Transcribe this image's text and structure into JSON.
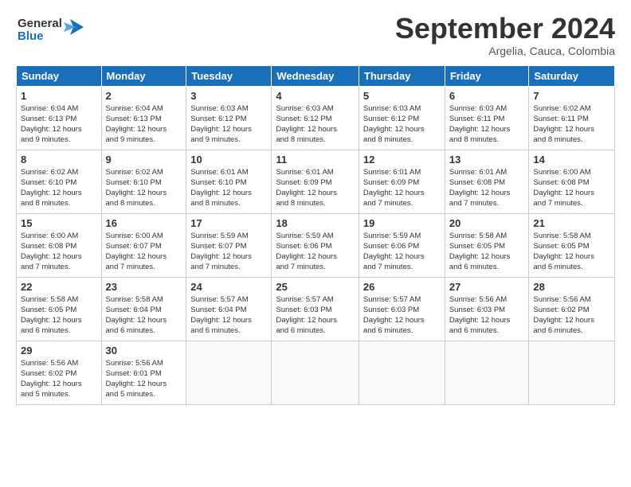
{
  "logo": {
    "line1": "General",
    "line2": "Blue"
  },
  "title": "September 2024",
  "subtitle": "Argelia, Cauca, Colombia",
  "headers": [
    "Sunday",
    "Monday",
    "Tuesday",
    "Wednesday",
    "Thursday",
    "Friday",
    "Saturday"
  ],
  "weeks": [
    [
      {
        "day": "1",
        "info": "Sunrise: 6:04 AM\nSunset: 6:13 PM\nDaylight: 12 hours\nand 9 minutes."
      },
      {
        "day": "2",
        "info": "Sunrise: 6:04 AM\nSunset: 6:13 PM\nDaylight: 12 hours\nand 9 minutes."
      },
      {
        "day": "3",
        "info": "Sunrise: 6:03 AM\nSunset: 6:12 PM\nDaylight: 12 hours\nand 9 minutes."
      },
      {
        "day": "4",
        "info": "Sunrise: 6:03 AM\nSunset: 6:12 PM\nDaylight: 12 hours\nand 8 minutes."
      },
      {
        "day": "5",
        "info": "Sunrise: 6:03 AM\nSunset: 6:12 PM\nDaylight: 12 hours\nand 8 minutes."
      },
      {
        "day": "6",
        "info": "Sunrise: 6:03 AM\nSunset: 6:11 PM\nDaylight: 12 hours\nand 8 minutes."
      },
      {
        "day": "7",
        "info": "Sunrise: 6:02 AM\nSunset: 6:11 PM\nDaylight: 12 hours\nand 8 minutes."
      }
    ],
    [
      {
        "day": "8",
        "info": "Sunrise: 6:02 AM\nSunset: 6:10 PM\nDaylight: 12 hours\nand 8 minutes."
      },
      {
        "day": "9",
        "info": "Sunrise: 6:02 AM\nSunset: 6:10 PM\nDaylight: 12 hours\nand 8 minutes."
      },
      {
        "day": "10",
        "info": "Sunrise: 6:01 AM\nSunset: 6:10 PM\nDaylight: 12 hours\nand 8 minutes."
      },
      {
        "day": "11",
        "info": "Sunrise: 6:01 AM\nSunset: 6:09 PM\nDaylight: 12 hours\nand 8 minutes."
      },
      {
        "day": "12",
        "info": "Sunrise: 6:01 AM\nSunset: 6:09 PM\nDaylight: 12 hours\nand 7 minutes."
      },
      {
        "day": "13",
        "info": "Sunrise: 6:01 AM\nSunset: 6:08 PM\nDaylight: 12 hours\nand 7 minutes."
      },
      {
        "day": "14",
        "info": "Sunrise: 6:00 AM\nSunset: 6:08 PM\nDaylight: 12 hours\nand 7 minutes."
      }
    ],
    [
      {
        "day": "15",
        "info": "Sunrise: 6:00 AM\nSunset: 6:08 PM\nDaylight: 12 hours\nand 7 minutes."
      },
      {
        "day": "16",
        "info": "Sunrise: 6:00 AM\nSunset: 6:07 PM\nDaylight: 12 hours\nand 7 minutes."
      },
      {
        "day": "17",
        "info": "Sunrise: 5:59 AM\nSunset: 6:07 PM\nDaylight: 12 hours\nand 7 minutes."
      },
      {
        "day": "18",
        "info": "Sunrise: 5:59 AM\nSunset: 6:06 PM\nDaylight: 12 hours\nand 7 minutes."
      },
      {
        "day": "19",
        "info": "Sunrise: 5:59 AM\nSunset: 6:06 PM\nDaylight: 12 hours\nand 7 minutes."
      },
      {
        "day": "20",
        "info": "Sunrise: 5:58 AM\nSunset: 6:05 PM\nDaylight: 12 hours\nand 6 minutes."
      },
      {
        "day": "21",
        "info": "Sunrise: 5:58 AM\nSunset: 6:05 PM\nDaylight: 12 hours\nand 6 minutes."
      }
    ],
    [
      {
        "day": "22",
        "info": "Sunrise: 5:58 AM\nSunset: 6:05 PM\nDaylight: 12 hours\nand 6 minutes."
      },
      {
        "day": "23",
        "info": "Sunrise: 5:58 AM\nSunset: 6:04 PM\nDaylight: 12 hours\nand 6 minutes."
      },
      {
        "day": "24",
        "info": "Sunrise: 5:57 AM\nSunset: 6:04 PM\nDaylight: 12 hours\nand 6 minutes."
      },
      {
        "day": "25",
        "info": "Sunrise: 5:57 AM\nSunset: 6:03 PM\nDaylight: 12 hours\nand 6 minutes."
      },
      {
        "day": "26",
        "info": "Sunrise: 5:57 AM\nSunset: 6:03 PM\nDaylight: 12 hours\nand 6 minutes."
      },
      {
        "day": "27",
        "info": "Sunrise: 5:56 AM\nSunset: 6:03 PM\nDaylight: 12 hours\nand 6 minutes."
      },
      {
        "day": "28",
        "info": "Sunrise: 5:56 AM\nSunset: 6:02 PM\nDaylight: 12 hours\nand 6 minutes."
      }
    ],
    [
      {
        "day": "29",
        "info": "Sunrise: 5:56 AM\nSunset: 6:02 PM\nDaylight: 12 hours\nand 5 minutes."
      },
      {
        "day": "30",
        "info": "Sunrise: 5:56 AM\nSunset: 6:01 PM\nDaylight: 12 hours\nand 5 minutes."
      },
      {
        "day": "",
        "info": ""
      },
      {
        "day": "",
        "info": ""
      },
      {
        "day": "",
        "info": ""
      },
      {
        "day": "",
        "info": ""
      },
      {
        "day": "",
        "info": ""
      }
    ]
  ]
}
